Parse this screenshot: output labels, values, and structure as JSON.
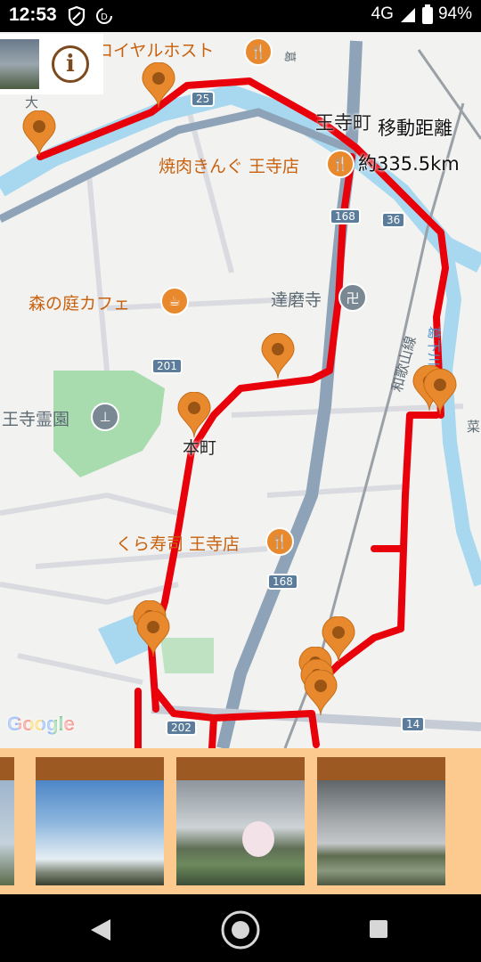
{
  "status_bar": {
    "time": "12:53",
    "network": "4G",
    "battery": "94%",
    "icons": [
      "shield-icon",
      "data-saver-icon",
      "signal-icon",
      "battery-icon"
    ]
  },
  "info_panel": {
    "info_symbol": "i"
  },
  "map": {
    "town_label": "王寺町",
    "distance_label": "移動距離",
    "distance_value": "約335.5km",
    "colors": {
      "route": "#e8000b",
      "pin": "#e8892e",
      "water": "#a8d8ef",
      "park": "#a8dcae",
      "highway": "#8ea3b8"
    },
    "poi_labels": [
      {
        "name": "royal-host",
        "text": "ロイヤルホスト"
      },
      {
        "name": "yakiniku",
        "text": "焼肉きんぐ 王寺店"
      },
      {
        "name": "cafe",
        "text": "森の庭カフェ"
      },
      {
        "name": "temple",
        "text": "達磨寺"
      },
      {
        "name": "cemetery",
        "text": "王寺霊園"
      },
      {
        "name": "honmachi",
        "text": "本町"
      },
      {
        "name": "kura-sushi",
        "text": "くら寿司 王寺店"
      },
      {
        "name": "wakayama-line",
        "text": "和歌山線"
      },
      {
        "name": "yamato-river-fragment",
        "text": "大"
      },
      {
        "name": "east-fragment",
        "text": "葛"
      },
      {
        "name": "river-fragment",
        "text": "葛下川"
      },
      {
        "name": "cemetery-fragment",
        "text": "菜"
      }
    ],
    "road_numbers": [
      "25",
      "168",
      "36",
      "201",
      "168",
      "202",
      "14"
    ],
    "google_logo": "Google"
  },
  "gallery": {
    "photos": [
      {
        "name": "photo-partial"
      },
      {
        "name": "photo-sky-clouds"
      },
      {
        "name": "photo-cherry-blossom"
      },
      {
        "name": "photo-river-cloudy"
      }
    ]
  },
  "nav_bar": {
    "icons": [
      "back-icon",
      "home-icon",
      "recents-icon"
    ]
  }
}
